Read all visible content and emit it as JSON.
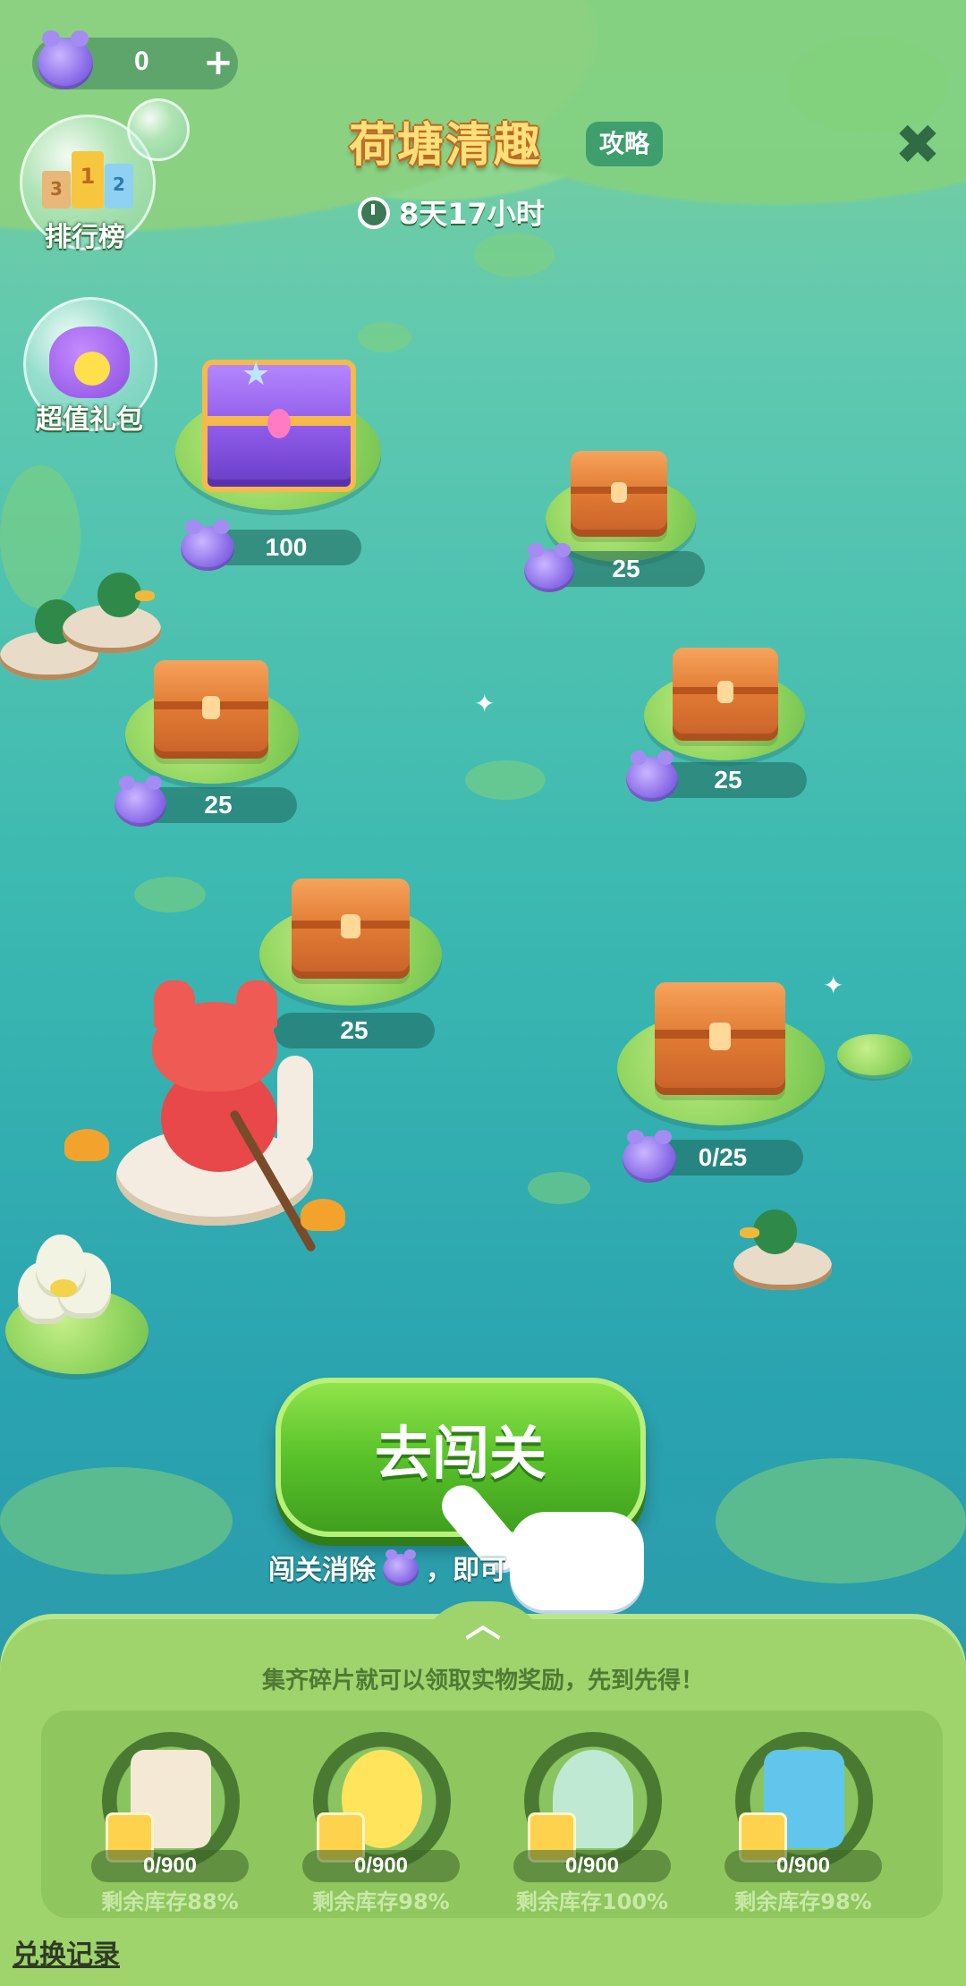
{
  "currency": {
    "value": "0",
    "plus": "+"
  },
  "leaderboard": {
    "label": "排行榜",
    "podium": [
      "3",
      "1",
      "2"
    ]
  },
  "gift_pack": {
    "label": "超值礼包"
  },
  "event": {
    "title": "荷塘清趣",
    "guide": "攻略",
    "timer": "8天17小时"
  },
  "close": "✖",
  "chests": [
    {
      "reward": "100"
    },
    {
      "reward": "25"
    },
    {
      "reward": "25"
    },
    {
      "reward": "25"
    },
    {
      "reward": "25"
    },
    {
      "reward": "0/25"
    }
  ],
  "go_button": "去闯关",
  "hint": {
    "before": "闯关消除",
    "after": "，即可"
  },
  "panel": {
    "chevron": "︿",
    "tip": "集齐碎片就可以领取实物奖励，先到先得！",
    "prizes": [
      {
        "count": "0/900",
        "stock": "剩余库存88%",
        "color": "#f3e9d4"
      },
      {
        "count": "0/900",
        "stock": "剩余库存98%",
        "color": "#ffe45c"
      },
      {
        "count": "0/900",
        "stock": "剩余库存100%",
        "color": "#bfe9d2"
      },
      {
        "count": "0/900",
        "stock": "剩余库存98%",
        "color": "#62c6ec"
      }
    ],
    "history": "兑换记录"
  }
}
